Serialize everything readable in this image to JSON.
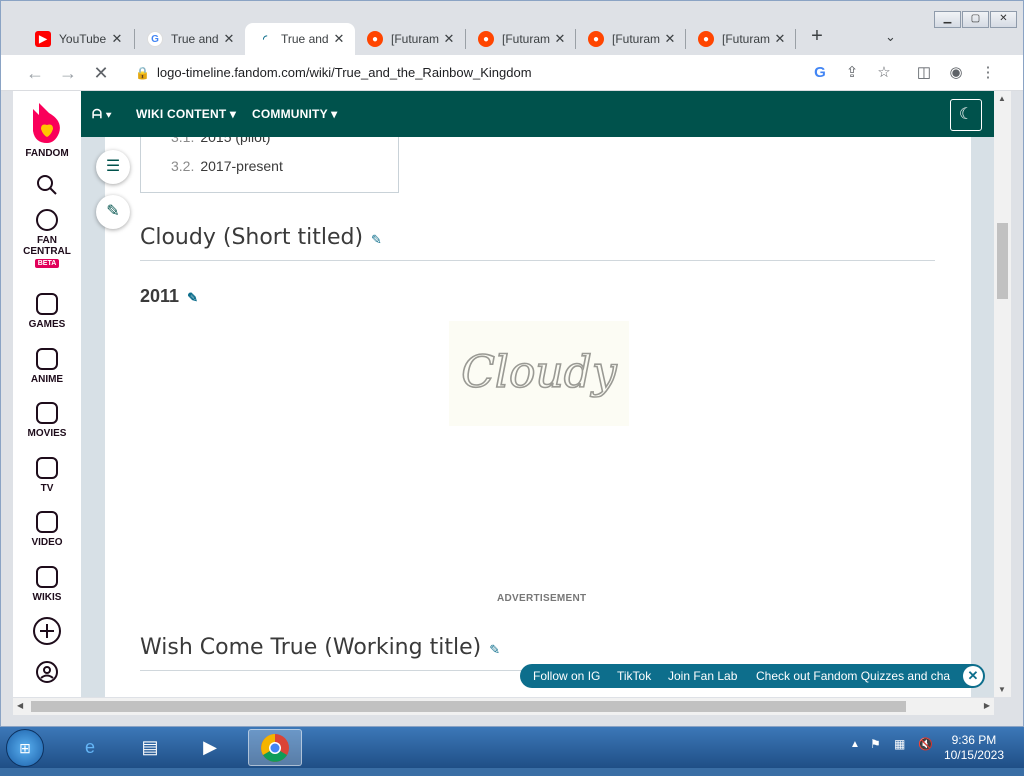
{
  "tabs": [
    {
      "title": "YouTube",
      "icon": "youtube-icon",
      "color": "#ff0000",
      "active": false
    },
    {
      "title": "True and",
      "icon": "google-icon",
      "color": "#4285f4",
      "active": false
    },
    {
      "title": "True and",
      "icon": "fandom-loading-icon",
      "color": "#0d6e8c",
      "active": true
    },
    {
      "title": "[Futuram",
      "icon": "reddit-icon",
      "color": "#ff4500",
      "active": false
    },
    {
      "title": "[Futuram",
      "icon": "reddit-icon",
      "color": "#ff4500",
      "active": false
    },
    {
      "title": "[Futuram",
      "icon": "reddit-icon",
      "color": "#ff4500",
      "active": false
    },
    {
      "title": "[Futuram",
      "icon": "reddit-icon",
      "color": "#ff4500",
      "active": false
    }
  ],
  "address": {
    "url": "logo-timeline.fandom.com/wiki/True_and_the_Rainbow_Kingdom"
  },
  "rail": {
    "fandom": "FANDOM",
    "fan_central_1": "FAN",
    "fan_central_2": "CENTRAL",
    "beta": "BETA",
    "games": "GAMES",
    "anime": "ANIME",
    "movies": "MOVIES",
    "tv": "TV",
    "video": "VIDEO",
    "wikis": "WIKIS"
  },
  "wikinav": {
    "wiki_content": "WIKI CONTENT",
    "community": "COMMUNITY"
  },
  "toc": [
    {
      "num": "3.1.",
      "label": "2015 (pilot)"
    },
    {
      "num": "3.2.",
      "label": "2017-present"
    }
  ],
  "sections": {
    "cloudy_title": "Cloudy (Short titled)",
    "year": "2011",
    "logo_text": "Cloudy",
    "advertisement": "ADVERTISEMENT",
    "wish_title": "Wish Come True (Working title)"
  },
  "followbar": {
    "ig": "Follow on IG",
    "tiktok": "TikTok",
    "fanlab": "Join Fan Lab",
    "quizzes": "Check out Fandom Quizzes and cha"
  },
  "clock": {
    "time": "9:36 PM",
    "date": "10/15/2023"
  },
  "colors": {
    "wiki_nav": "#00524c",
    "accent": "#0d6e8c",
    "fandom_pink": "#fa005a"
  }
}
